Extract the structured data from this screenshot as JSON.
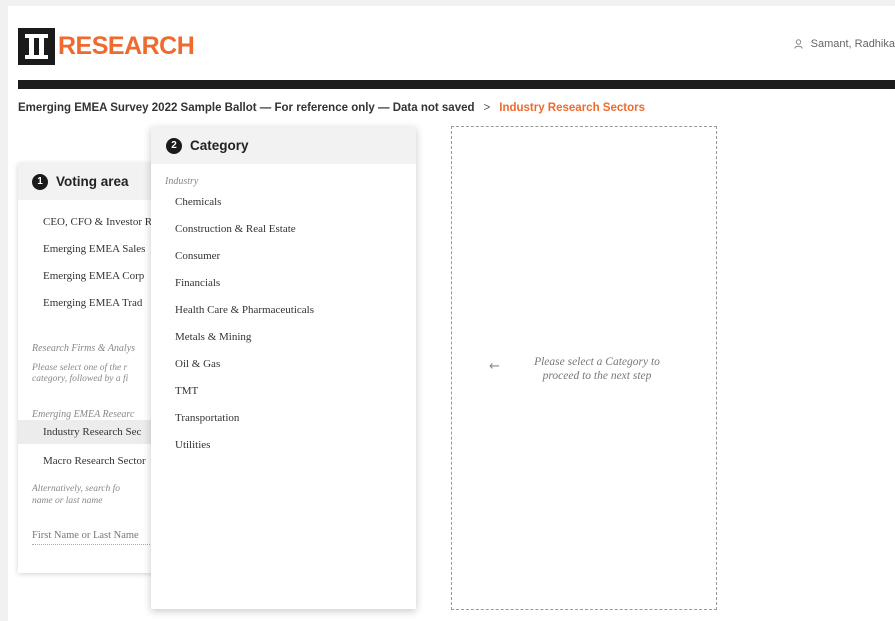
{
  "brand": {
    "logo_text": "RESEARCH",
    "accent": "#ef6a2e"
  },
  "user": {
    "name": "Samant, Radhika",
    "icon": "user-icon"
  },
  "breadcrumb": {
    "survey": "Emerging EMEA Survey 2022 Sample Ballot — For reference only — Data not saved",
    "separator": ">",
    "current": "Industry Research Sectors"
  },
  "voting": {
    "step": "1",
    "title": "Voting area",
    "items": [
      "CEO, CFO & Investor R",
      "Emerging EMEA Sales",
      "Emerging EMEA Corp",
      "Emerging EMEA Trad"
    ],
    "research_label": "Research Firms & Analys",
    "research_help_1": "Please select one of the r",
    "research_help_2": "category, followed by a fi",
    "research_section": "Emerging EMEA Researc",
    "selected_item": "Industry Research Sec",
    "macro_item": "Macro Research Sector",
    "search_help_1": "Alternatively,  search  fo",
    "search_help_2": "name or last name",
    "search_placeholder": "First Name or Last Name"
  },
  "category": {
    "step": "2",
    "title": "Category",
    "subtitle": "Industry",
    "items": [
      "Chemicals",
      "Construction & Real Estate",
      "Consumer",
      "Financials",
      "Health Care & Pharmaceuticals",
      "Metals & Mining",
      "Oil & Gas",
      "TMT",
      "Transportation",
      "Utilities"
    ]
  },
  "next_step": {
    "arrow": "←",
    "message": "Please select a Category to proceed to the next step"
  }
}
